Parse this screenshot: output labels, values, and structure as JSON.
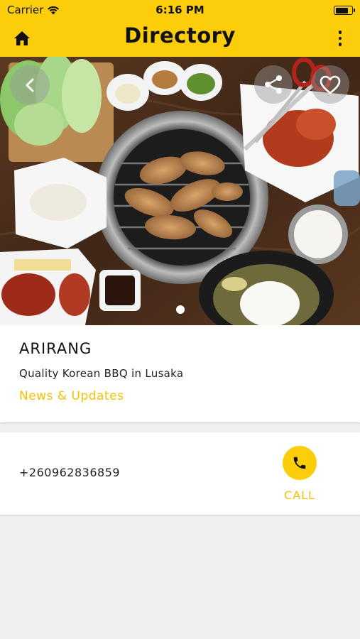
{
  "status_bar": {
    "carrier": "Carrier",
    "time": "6:16 PM",
    "battery_level": 0.85
  },
  "app_bar": {
    "title": "Directory",
    "left_icon": "home-icon",
    "right_icon": "more-vertical-icon"
  },
  "hero": {
    "back_icon": "chevron-left-icon",
    "share_icon": "share-icon",
    "favorite_icon": "heart-outline-icon",
    "page_count": 1,
    "current_page": 1
  },
  "listing": {
    "name": "ARIRANG",
    "tagline": "Quality Korean BBQ in Lusaka",
    "news_link": "News & Updates"
  },
  "contact": {
    "phone": "+260962836859",
    "call_label": "CALL",
    "call_icon": "phone-icon"
  },
  "colors": {
    "accent": "#fccd0a",
    "accent_text": "#f5c200",
    "background": "#efefef"
  }
}
